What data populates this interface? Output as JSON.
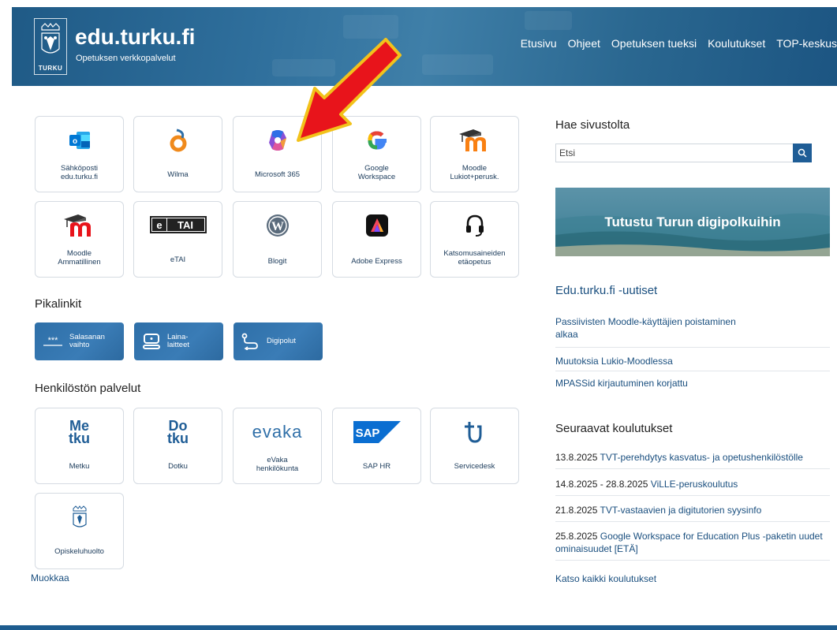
{
  "header": {
    "logo_text": "TURKU",
    "title": "edu.turku.fi",
    "subtitle": "Opetuksen verkkopalvelut",
    "nav": [
      "Etusivu",
      "Ohjeet",
      "Opetuksen tueksi",
      "Koulutukset",
      "TOP-keskus"
    ]
  },
  "services": [
    {
      "label1": "Sähköposti",
      "label2": "edu.turku.fi",
      "icon": "outlook-icon"
    },
    {
      "label1": "Wilma",
      "label2": "",
      "icon": "wilma-icon"
    },
    {
      "label1": "Microsoft 365",
      "label2": "",
      "icon": "microsoft365-icon"
    },
    {
      "label1": "Google",
      "label2": "Workspace",
      "icon": "google-icon"
    },
    {
      "label1": "Moodle",
      "label2": "Lukiot+perusk.",
      "icon": "moodle-icon"
    },
    {
      "label1": "Moodle",
      "label2": "Ammatillinen",
      "icon": "moodle-icon"
    },
    {
      "label1": "eTAI",
      "label2": "",
      "icon": "etai-icon"
    },
    {
      "label1": "Blogit",
      "label2": "",
      "icon": "wordpress-icon"
    },
    {
      "label1": "Adobe Express",
      "label2": "",
      "icon": "adobe-express-icon"
    },
    {
      "label1": "Katsomusaineiden",
      "label2": "etäopetus",
      "icon": "headset-icon"
    }
  ],
  "quicklinks_title": "Pikalinkit",
  "quicklinks": [
    {
      "label1": "Salasanan",
      "label2": "vaihto",
      "icon": "password-icon",
      "icon_text": "***"
    },
    {
      "label1": "Laina-",
      "label2": "laitteet",
      "icon": "device-icon"
    },
    {
      "label1": "Digipolut",
      "label2": "",
      "icon": "path-icon"
    }
  ],
  "staff_title": "Henkilöstön palvelut",
  "staff": [
    {
      "label1": "Metku",
      "label2": "",
      "icon": "metku-icon",
      "icon_text1": "Me",
      "icon_text2": "tku"
    },
    {
      "label1": "Dotku",
      "label2": "",
      "icon": "dotku-icon",
      "icon_text1": "Do",
      "icon_text2": "tku"
    },
    {
      "label1": "eVaka",
      "label2": "henkilökunta",
      "icon": "evaka-icon",
      "icon_text1": "evaka"
    },
    {
      "label1": "SAP HR",
      "label2": "",
      "icon": "sap-icon",
      "icon_text1": "SAP"
    },
    {
      "label1": "Servicedesk",
      "label2": "",
      "icon": "servicedesk-icon"
    },
    {
      "label1": "Opiskeluhuolto",
      "label2": "",
      "icon": "turku-crest-icon"
    }
  ],
  "edit_link": "Muokkaa",
  "sidebar": {
    "search_title": "Hae sivustolta",
    "search_placeholder": "Etsi",
    "banner_text": "Tutustu Turun digipolkuihin",
    "news_title": "Edu.turku.fi -uutiset",
    "news": [
      "Passiivisten Moodle-käyttäjien poistaminen alkaa",
      "Muutoksia Lukio-Moodlessa",
      "MPASSid kirjautuminen korjattu"
    ],
    "trainings_title": "Seuraavat koulutukset",
    "trainings": [
      {
        "date": "13.8.2025",
        "title": "TVT-perehdytys kasvatus- ja opetushenkilöstölle"
      },
      {
        "date": "14.8.2025 - 28.8.2025",
        "title": "ViLLE-peruskoulutus"
      },
      {
        "date": "21.8.2025",
        "title": "TVT-vastaavien ja digitutorien syysinfo"
      },
      {
        "date": "25.8.2025",
        "title": "Google Workspace for Education Plus -paketin uudet ominaisuudet [ETÄ]"
      }
    ],
    "all_trainings": "Katso kaikki koulutukset"
  },
  "colors": {
    "accent": "#1f5d96",
    "link": "#1a4f7f",
    "arrow": "#e8141b"
  }
}
